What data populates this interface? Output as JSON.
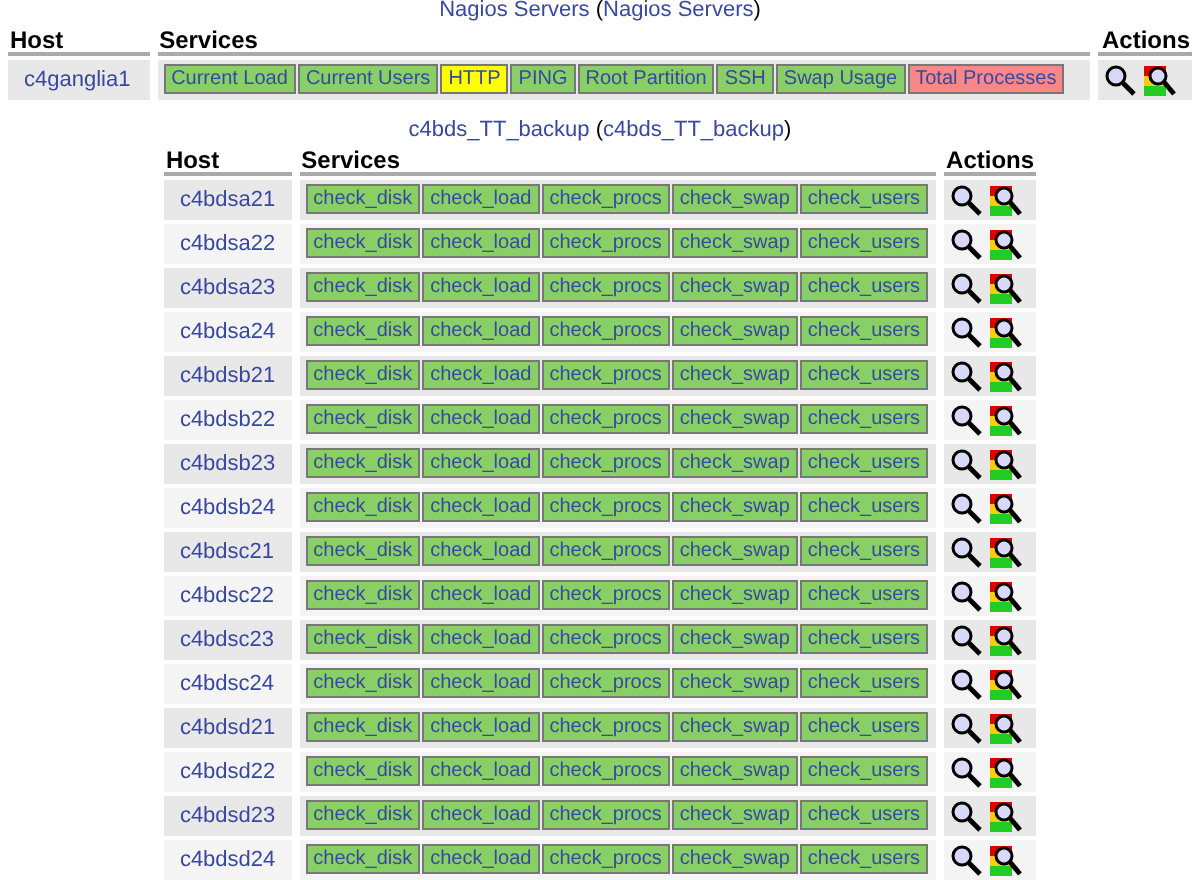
{
  "groups": [
    {
      "title": [
        {
          "text": "Nagios Servers",
          "kind": "link"
        },
        {
          "text": "(",
          "kind": "plain"
        },
        {
          "text": "Nagios Servers",
          "kind": "link"
        },
        {
          "text": ")",
          "kind": "plain"
        }
      ],
      "columns": [
        "Host",
        "Services",
        "Actions"
      ],
      "hosts": [
        {
          "name": "c4ganglia1",
          "services": [
            {
              "label": "Current Load",
              "color": "#88d066"
            },
            {
              "label": "Current Users",
              "color": "#88d066"
            },
            {
              "label": "HTTP",
              "color": "#ffff00"
            },
            {
              "label": "PING",
              "color": "#88d066"
            },
            {
              "label": "Root Partition",
              "color": "#88d066"
            },
            {
              "label": "SSH",
              "color": "#88d066"
            },
            {
              "label": "Swap Usage",
              "color": "#88d066"
            },
            {
              "label": "Total Processes",
              "color": "#f88888"
            }
          ]
        }
      ]
    },
    {
      "title": [
        {
          "text": "c4bds_TT_backup",
          "kind": "link"
        },
        {
          "text": "(",
          "kind": "plain"
        },
        {
          "text": "c4bds_TT_backup",
          "kind": "link"
        },
        {
          "text": ")",
          "kind": "plain"
        }
      ],
      "columns": [
        "Host",
        "Services",
        "Actions"
      ],
      "hosts": [
        {
          "name": "c4bdsa21",
          "services": [
            {
              "label": "check_disk",
              "color": "#88d066"
            },
            {
              "label": "check_load",
              "color": "#88d066"
            },
            {
              "label": "check_procs",
              "color": "#88d066"
            },
            {
              "label": "check_swap",
              "color": "#88d066"
            },
            {
              "label": "check_users",
              "color": "#88d066"
            }
          ]
        },
        {
          "name": "c4bdsa22",
          "services": [
            {
              "label": "check_disk",
              "color": "#88d066"
            },
            {
              "label": "check_load",
              "color": "#88d066"
            },
            {
              "label": "check_procs",
              "color": "#88d066"
            },
            {
              "label": "check_swap",
              "color": "#88d066"
            },
            {
              "label": "check_users",
              "color": "#88d066"
            }
          ]
        },
        {
          "name": "c4bdsa23",
          "services": [
            {
              "label": "check_disk",
              "color": "#88d066"
            },
            {
              "label": "check_load",
              "color": "#88d066"
            },
            {
              "label": "check_procs",
              "color": "#88d066"
            },
            {
              "label": "check_swap",
              "color": "#88d066"
            },
            {
              "label": "check_users",
              "color": "#88d066"
            }
          ]
        },
        {
          "name": "c4bdsa24",
          "services": [
            {
              "label": "check_disk",
              "color": "#88d066"
            },
            {
              "label": "check_load",
              "color": "#88d066"
            },
            {
              "label": "check_procs",
              "color": "#88d066"
            },
            {
              "label": "check_swap",
              "color": "#88d066"
            },
            {
              "label": "check_users",
              "color": "#88d066"
            }
          ]
        },
        {
          "name": "c4bdsb21",
          "services": [
            {
              "label": "check_disk",
              "color": "#88d066"
            },
            {
              "label": "check_load",
              "color": "#88d066"
            },
            {
              "label": "check_procs",
              "color": "#88d066"
            },
            {
              "label": "check_swap",
              "color": "#88d066"
            },
            {
              "label": "check_users",
              "color": "#88d066"
            }
          ]
        },
        {
          "name": "c4bdsb22",
          "services": [
            {
              "label": "check_disk",
              "color": "#88d066"
            },
            {
              "label": "check_load",
              "color": "#88d066"
            },
            {
              "label": "check_procs",
              "color": "#88d066"
            },
            {
              "label": "check_swap",
              "color": "#88d066"
            },
            {
              "label": "check_users",
              "color": "#88d066"
            }
          ]
        },
        {
          "name": "c4bdsb23",
          "services": [
            {
              "label": "check_disk",
              "color": "#88d066"
            },
            {
              "label": "check_load",
              "color": "#88d066"
            },
            {
              "label": "check_procs",
              "color": "#88d066"
            },
            {
              "label": "check_swap",
              "color": "#88d066"
            },
            {
              "label": "check_users",
              "color": "#88d066"
            }
          ]
        },
        {
          "name": "c4bdsb24",
          "services": [
            {
              "label": "check_disk",
              "color": "#88d066"
            },
            {
              "label": "check_load",
              "color": "#88d066"
            },
            {
              "label": "check_procs",
              "color": "#88d066"
            },
            {
              "label": "check_swap",
              "color": "#88d066"
            },
            {
              "label": "check_users",
              "color": "#88d066"
            }
          ]
        },
        {
          "name": "c4bdsc21",
          "services": [
            {
              "label": "check_disk",
              "color": "#88d066"
            },
            {
              "label": "check_load",
              "color": "#88d066"
            },
            {
              "label": "check_procs",
              "color": "#88d066"
            },
            {
              "label": "check_swap",
              "color": "#88d066"
            },
            {
              "label": "check_users",
              "color": "#88d066"
            }
          ]
        },
        {
          "name": "c4bdsc22",
          "services": [
            {
              "label": "check_disk",
              "color": "#88d066"
            },
            {
              "label": "check_load",
              "color": "#88d066"
            },
            {
              "label": "check_procs",
              "color": "#88d066"
            },
            {
              "label": "check_swap",
              "color": "#88d066"
            },
            {
              "label": "check_users",
              "color": "#88d066"
            }
          ]
        },
        {
          "name": "c4bdsc23",
          "services": [
            {
              "label": "check_disk",
              "color": "#88d066"
            },
            {
              "label": "check_load",
              "color": "#88d066"
            },
            {
              "label": "check_procs",
              "color": "#88d066"
            },
            {
              "label": "check_swap",
              "color": "#88d066"
            },
            {
              "label": "check_users",
              "color": "#88d066"
            }
          ]
        },
        {
          "name": "c4bdsc24",
          "services": [
            {
              "label": "check_disk",
              "color": "#88d066"
            },
            {
              "label": "check_load",
              "color": "#88d066"
            },
            {
              "label": "check_procs",
              "color": "#88d066"
            },
            {
              "label": "check_swap",
              "color": "#88d066"
            },
            {
              "label": "check_users",
              "color": "#88d066"
            }
          ]
        },
        {
          "name": "c4bdsd21",
          "services": [
            {
              "label": "check_disk",
              "color": "#88d066"
            },
            {
              "label": "check_load",
              "color": "#88d066"
            },
            {
              "label": "check_procs",
              "color": "#88d066"
            },
            {
              "label": "check_swap",
              "color": "#88d066"
            },
            {
              "label": "check_users",
              "color": "#88d066"
            }
          ]
        },
        {
          "name": "c4bdsd22",
          "services": [
            {
              "label": "check_disk",
              "color": "#88d066"
            },
            {
              "label": "check_load",
              "color": "#88d066"
            },
            {
              "label": "check_procs",
              "color": "#88d066"
            },
            {
              "label": "check_swap",
              "color": "#88d066"
            },
            {
              "label": "check_users",
              "color": "#88d066"
            }
          ]
        },
        {
          "name": "c4bdsd23",
          "services": [
            {
              "label": "check_disk",
              "color": "#88d066"
            },
            {
              "label": "check_load",
              "color": "#88d066"
            },
            {
              "label": "check_procs",
              "color": "#88d066"
            },
            {
              "label": "check_swap",
              "color": "#88d066"
            },
            {
              "label": "check_users",
              "color": "#88d066"
            }
          ]
        },
        {
          "name": "c4bdsd24",
          "services": [
            {
              "label": "check_disk",
              "color": "#88d066"
            },
            {
              "label": "check_load",
              "color": "#88d066"
            },
            {
              "label": "check_procs",
              "color": "#88d066"
            },
            {
              "label": "check_swap",
              "color": "#88d066"
            },
            {
              "label": "check_users",
              "color": "#88d066"
            }
          ]
        }
      ]
    }
  ]
}
